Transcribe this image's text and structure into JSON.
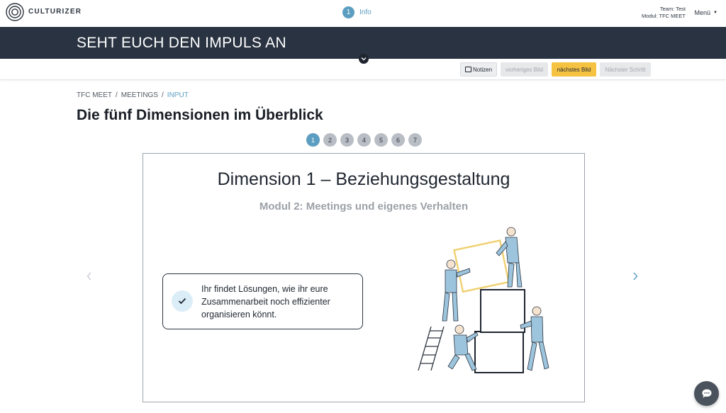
{
  "brand": {
    "name": "CULTURIZER",
    "logo_icon": "concentric-circles-logo"
  },
  "progress": {
    "step_number": "1",
    "step_label": "Info"
  },
  "team": {
    "team_line": "Team: Test",
    "module_line": "Modul: TFC MEET"
  },
  "menu": {
    "label": "Menü"
  },
  "banner": {
    "title": "SEHT EUCH DEN IMPULS AN",
    "toggle_icon": "chevron-down-icon"
  },
  "toolbar": {
    "notes_label": "Notizen",
    "prev_label": "vorheriges Bild",
    "next_label": "nächstes Bild",
    "next_step_label": "Nächster Schritt"
  },
  "breadcrumb": [
    {
      "label": "TFC MEET"
    },
    {
      "label": "MEETINGS"
    },
    {
      "label": "INPUT"
    }
  ],
  "breadcrumb_separator": "/",
  "page_title": "Die fünf Dimensionen im Überblick",
  "pager": {
    "pages": [
      "1",
      "2",
      "3",
      "4",
      "5",
      "6",
      "7"
    ],
    "active": "1"
  },
  "slide": {
    "title": "Dimension 1 – Beziehungsgestaltung",
    "subtitle": "Modul 2: Meetings und eigenes Verhalten",
    "callout": "Ihr findet Lösungen, wie ihr eure Zusammenarbeit noch effizienter organisieren könnt.",
    "callout_icon": "checkmark-icon",
    "illustration": "people-stacking-boxes-illustration"
  },
  "colors": {
    "banner": "#293341",
    "accent": "#5b9ec1",
    "primary_button": "#f5c242",
    "disabled_button": "#e6e8ea",
    "illustration_box": "#f0d070",
    "illustration_people": "#9cc4dc"
  }
}
